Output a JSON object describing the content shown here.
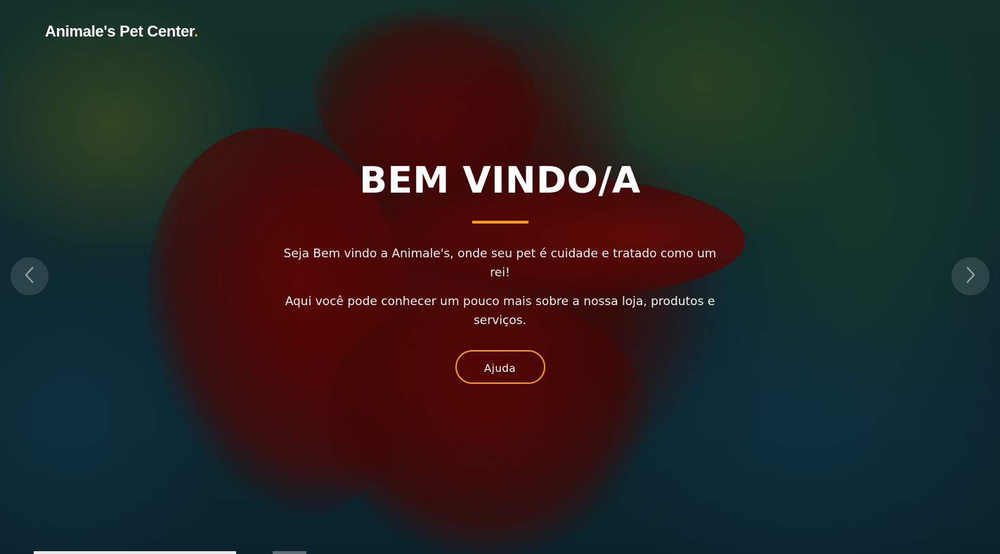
{
  "header": {
    "brand_text": "Animale's Pet Center",
    "brand_dot": "."
  },
  "hero": {
    "title": "BEM VINDO/A",
    "paragraph_1": "Seja Bem vindo a Animale's, onde seu pet é cuidade e tratado como um rei!",
    "paragraph_2": "Aqui você pode conhecer um pouco mais sobre a nossa loja, produtos e serviços.",
    "button_label": "Ajuda"
  },
  "carousel": {
    "prev_icon": "chevron-left-icon",
    "next_icon": "chevron-right-icon",
    "slide_count": 2,
    "active_slide": 1
  },
  "colors": {
    "accent": "#f39c12",
    "text": "#ffffff"
  }
}
